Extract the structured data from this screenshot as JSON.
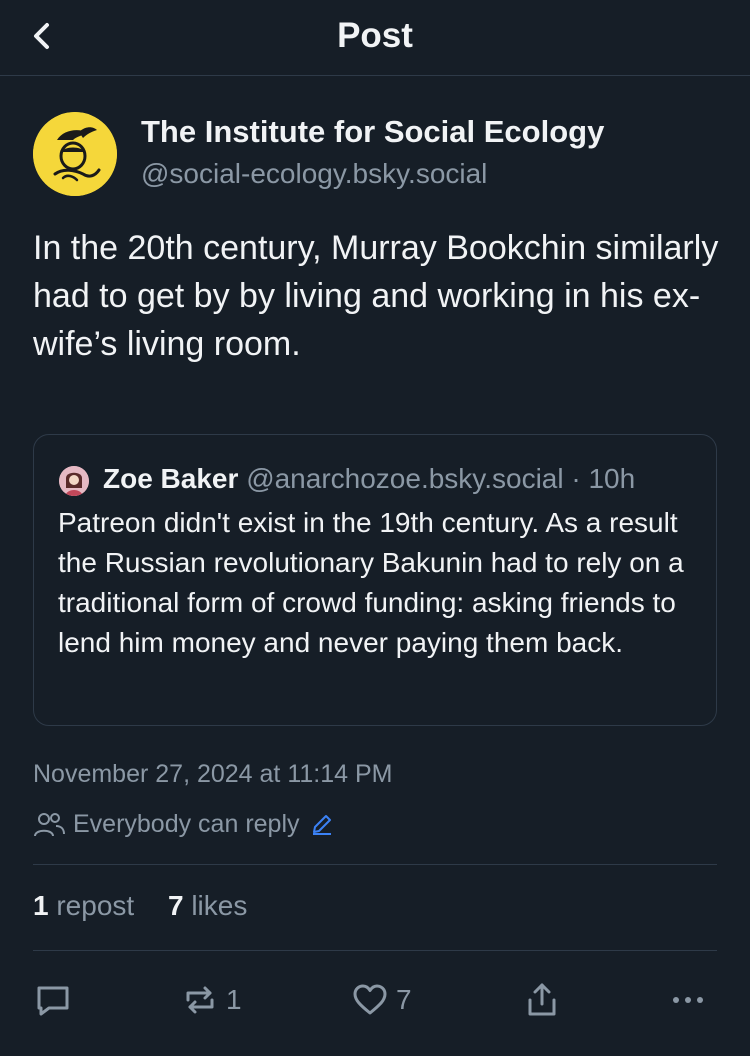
{
  "header": {
    "title": "Post",
    "back_icon": "chevron-left-icon"
  },
  "post": {
    "author_name": "The Institute for Social Ecology",
    "author_handle": "@social-ecology.bsky.social",
    "avatar_color": "#f5d73a",
    "text": "In the 20th century, Murray Bookchin similarly had to get by by living and working in his ex-wife’s living room.",
    "quote": {
      "author_name": "Zoe Baker",
      "author_handle": "@anarchozoe.bsky.social · 10h",
      "text": "Patreon didn't exist in the 19th century. As a result the Russian revolutionary Bakunin had to rely on a traditional form of crowd funding: asking friends to lend him money and never paying them back."
    },
    "timestamp": "November 27, 2024 at 11:14 PM",
    "reply_setting": "Everybody can reply",
    "stats": {
      "reposts_count": "1",
      "reposts_label": "repost",
      "likes_count": "7",
      "likes_label": "likes"
    }
  },
  "actions": {
    "reply_icon": "comment-icon",
    "repost_icon": "repost-icon",
    "repost_count": "1",
    "like_icon": "heart-icon",
    "like_count": "7",
    "share_icon": "share-icon",
    "more_icon": "more-icon"
  },
  "colors": {
    "background": "#161e27",
    "text_primary": "#f1f3f5",
    "text_secondary": "#8b98a5",
    "divider": "#2e3a48",
    "accent_link": "#3b82f6"
  }
}
